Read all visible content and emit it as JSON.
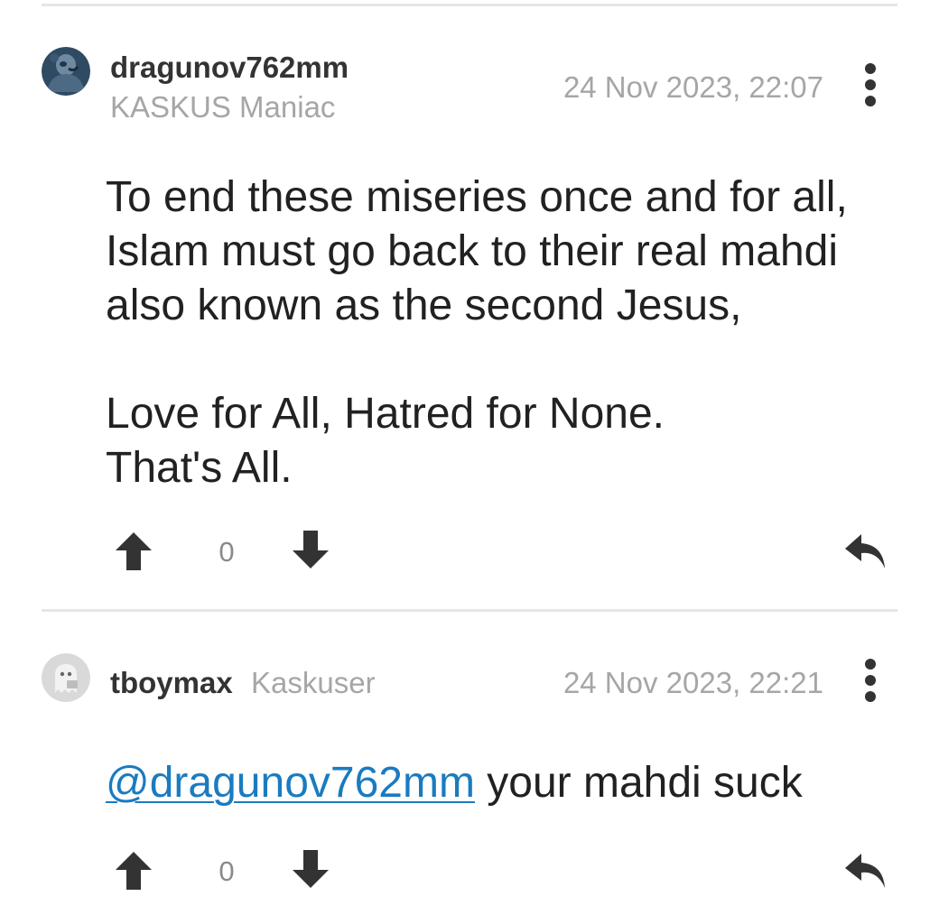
{
  "posts": [
    {
      "username": "dragunov762mm",
      "rank": "KASKUS Maniac",
      "timestamp": "24 Nov 2023, 22:07",
      "body_lines": [
        "To end these miseries once and for all,",
        "Islam must go back to their real mahdi",
        "also known as the second Jesus,",
        "",
        "Love for All, Hatred for None.",
        "That's All."
      ],
      "vote_count": "0",
      "avatar_icon": "user-avatar-photo"
    },
    {
      "username": "tboymax",
      "rank": "Kaskuser",
      "timestamp": "24 Nov 2023, 22:21",
      "mention": "@dragunov762mm",
      "body_rest": " your mahdi suck",
      "vote_count": "0",
      "avatar_icon": "default-ghost-avatar"
    }
  ],
  "icons": {
    "upvote": "arrow-up-icon",
    "downvote": "arrow-down-icon",
    "reply": "reply-icon",
    "more": "more-vertical-icon"
  },
  "colors": {
    "mention": "#1a7bc0",
    "muted_text": "#a6a6a6",
    "icon": "#333333",
    "divider": "#e6e6e6"
  }
}
